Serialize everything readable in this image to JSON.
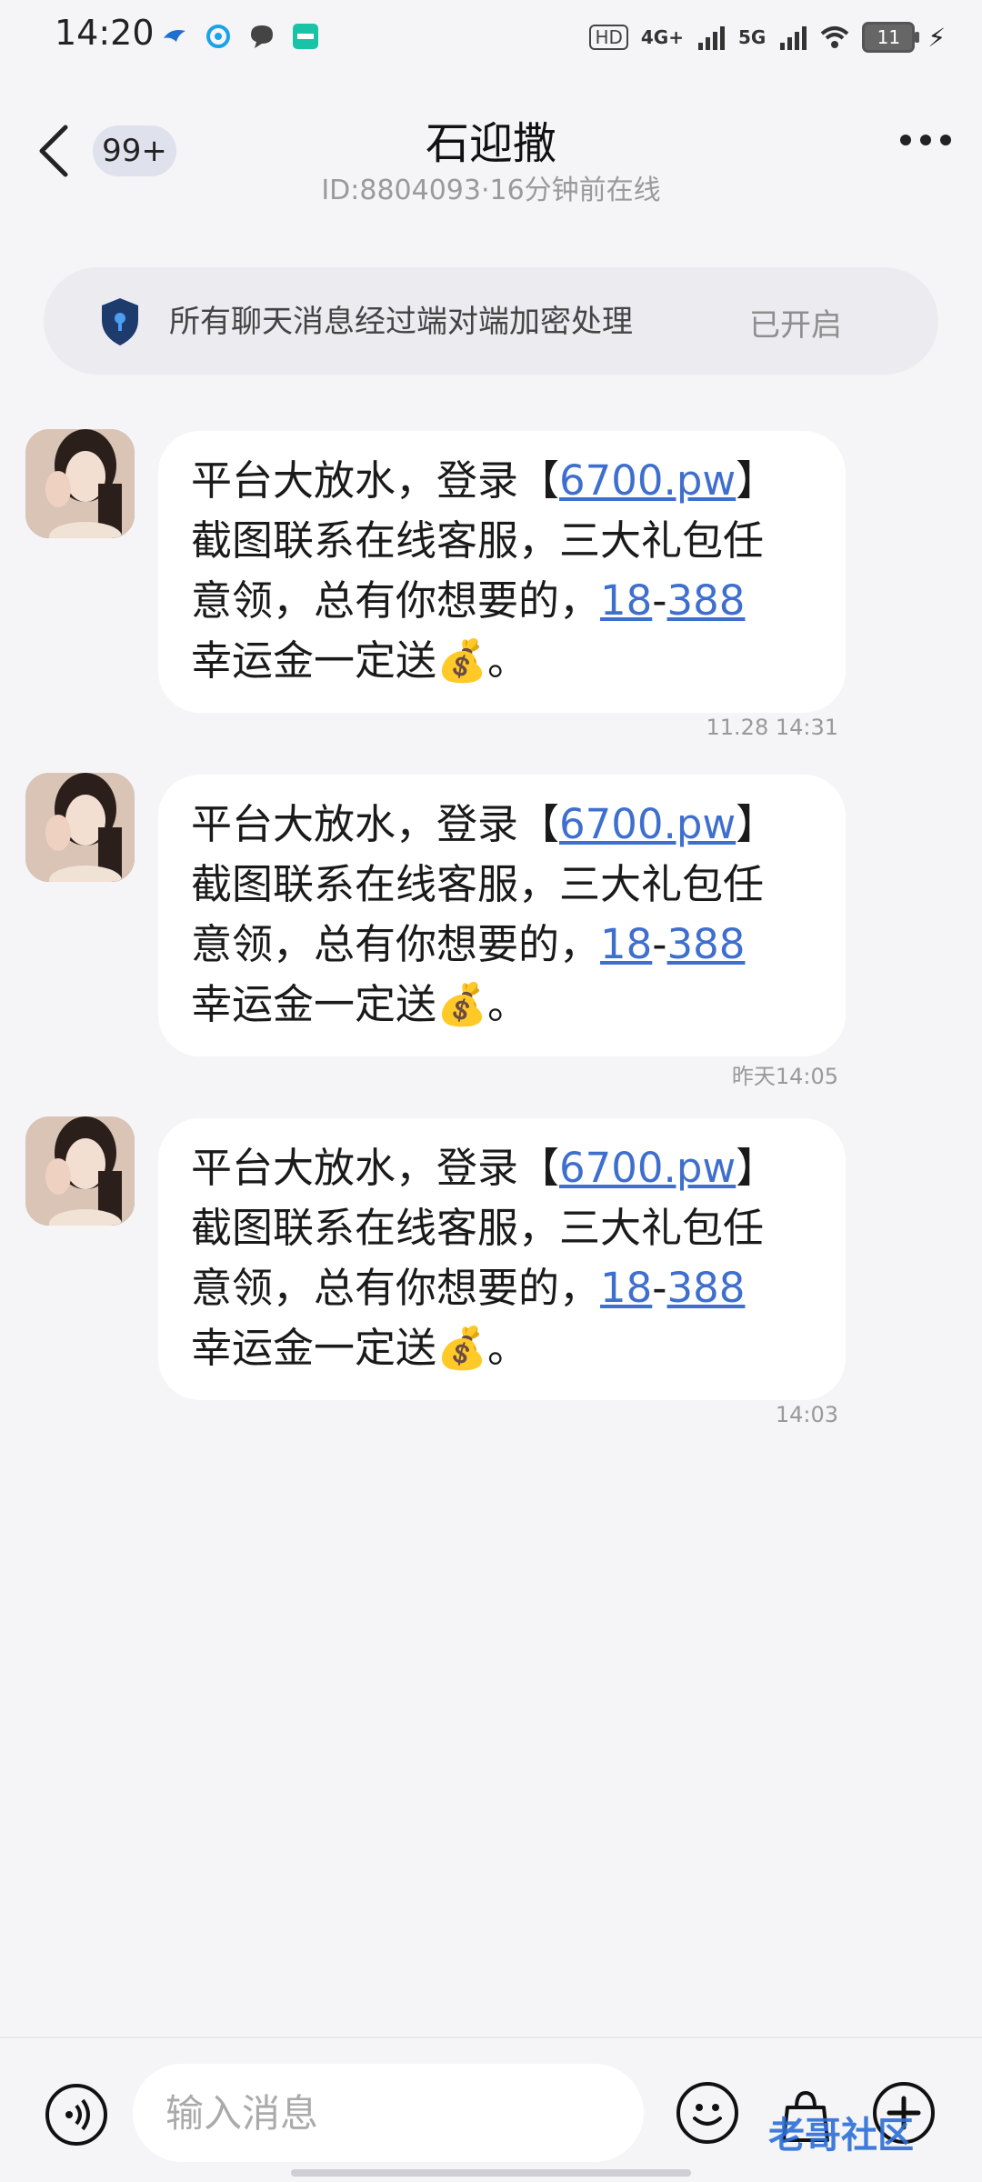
{
  "status_bar": {
    "time": "14:20",
    "left_icons": [
      "bird-icon",
      "browser-icon",
      "chat-icon",
      "boss-app-icon"
    ],
    "hd_label": "HD",
    "network_4g": "4G+",
    "network_5g": "5G",
    "battery": "11"
  },
  "header": {
    "unread_badge": "99+",
    "contact_name": "石迎撒",
    "contact_subtitle": "ID:8804093·16分钟前在线"
  },
  "encryption_banner": {
    "text": "所有聊天消息经过端对端加密处理",
    "status": "已开启"
  },
  "messages": [
    {
      "line1_prefix": "平台大放水，登录【",
      "link_domain": "6700.pw",
      "line1_suffix": "】",
      "line2": "截图联系在线客服，三大礼包任",
      "line3_prefix": "意领，总有你想要的，",
      "link_a": "18",
      "dash": "-",
      "link_b": "388",
      "line4": "幸运金一定送💰。",
      "timestamp": "11.28 14:31"
    },
    {
      "line1_prefix": "平台大放水，登录【",
      "link_domain": "6700.pw",
      "line1_suffix": "】",
      "line2": "截图联系在线客服，三大礼包任",
      "line3_prefix": "意领，总有你想要的，",
      "link_a": "18",
      "dash": "-",
      "link_b": "388",
      "line4": "幸运金一定送💰。",
      "timestamp": "昨天14:05"
    },
    {
      "line1_prefix": "平台大放水，登录【",
      "link_domain": "6700.pw",
      "line1_suffix": "】",
      "line2": "截图联系在线客服，三大礼包任",
      "line3_prefix": "意领，总有你想要的，",
      "link_a": "18",
      "dash": "-",
      "link_b": "388",
      "line4": "幸运金一定送💰。",
      "timestamp": "14:03"
    }
  ],
  "composer": {
    "placeholder": "输入消息"
  },
  "watermark": "老哥社区",
  "colors": {
    "link": "#3f6fce",
    "background": "#f5f5f7",
    "bubble": "#ffffff",
    "shield": "#1e3b6e"
  }
}
